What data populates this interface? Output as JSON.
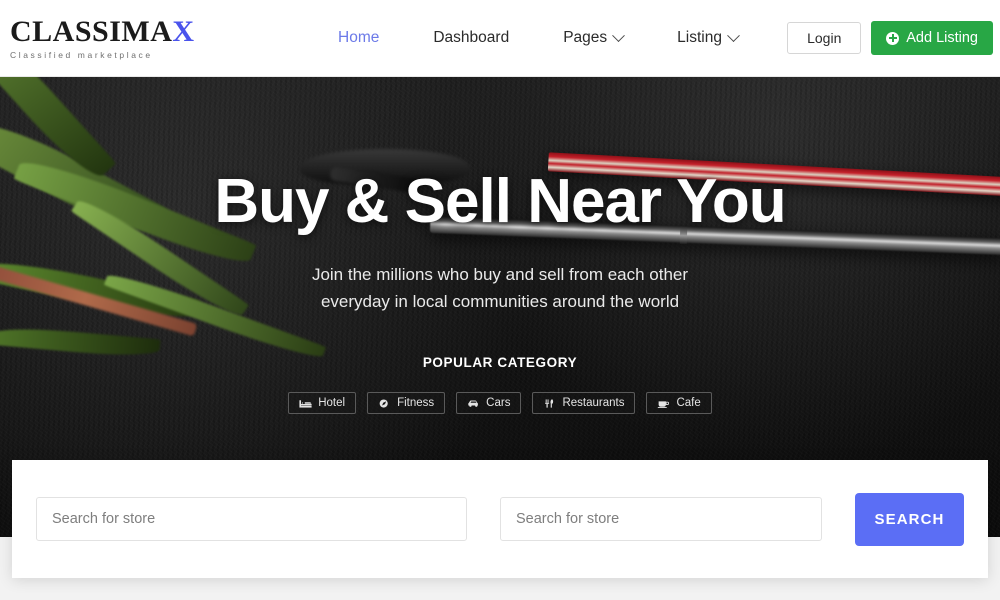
{
  "brand": {
    "name_main": "CLASSIMA",
    "name_accent": "X",
    "tagline": "Classified marketplace",
    "accent_color": "#4a53ec"
  },
  "nav": {
    "items": [
      {
        "label": "Home",
        "active": true,
        "has_caret": false
      },
      {
        "label": "Dashboard",
        "active": false,
        "has_caret": false
      },
      {
        "label": "Pages",
        "active": false,
        "has_caret": true
      },
      {
        "label": "Listing",
        "active": false,
        "has_caret": true
      }
    ]
  },
  "header_actions": {
    "login_label": "Login",
    "add_listing_label": "Add Listing",
    "add_listing_icon": "plus-circle-icon",
    "add_listing_color": "#28a745"
  },
  "hero": {
    "title": "Buy & Sell Near You",
    "subtitle_line1": "Join the millions who buy and sell from each other",
    "subtitle_line2": "everyday in local communities around the world",
    "popular_category_label": "POPULAR CATEGORY",
    "categories": [
      {
        "label": "Hotel",
        "icon": "bed-icon"
      },
      {
        "label": "Fitness",
        "icon": "fitness-icon"
      },
      {
        "label": "Cars",
        "icon": "car-icon"
      },
      {
        "label": "Restaurants",
        "icon": "utensils-icon"
      },
      {
        "label": "Cafe",
        "icon": "coffee-cup-icon"
      }
    ]
  },
  "search": {
    "store_placeholder": "Search for store",
    "location_placeholder": "Search for store",
    "store_value": "",
    "location_value": "",
    "button_label": "SEARCH",
    "button_color": "#5b6ef5"
  }
}
